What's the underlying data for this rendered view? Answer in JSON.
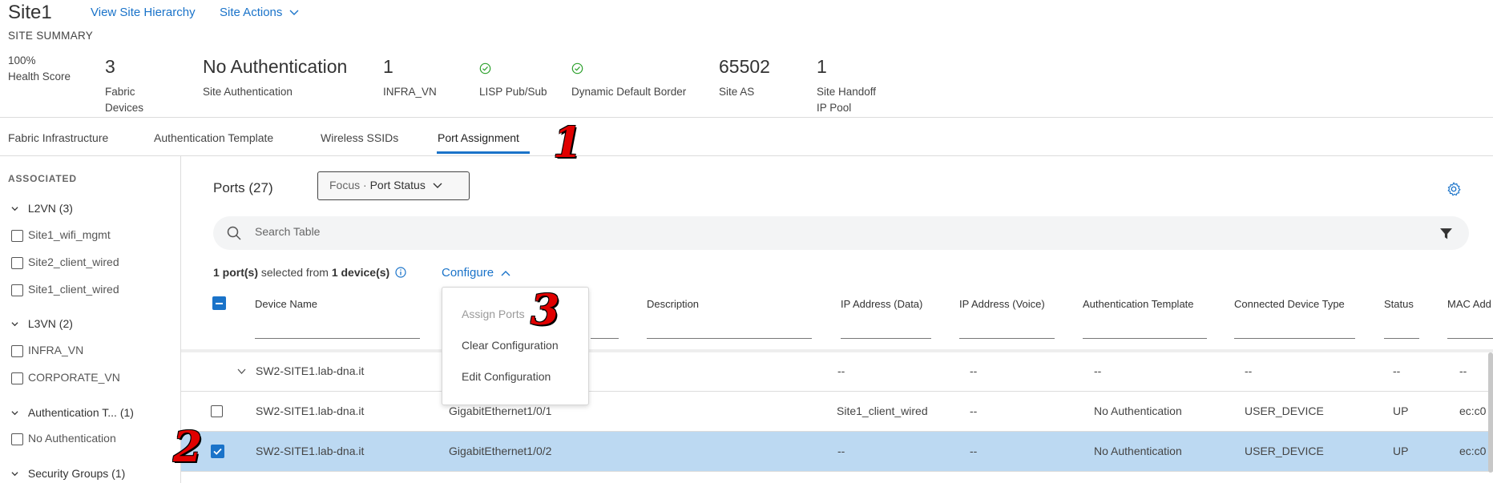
{
  "header": {
    "site_title": "Site1",
    "view_hierarchy": "View Site Hierarchy",
    "site_actions": "Site Actions",
    "site_summary": "SITE SUMMARY"
  },
  "summary": {
    "health_pct": "100%",
    "health_label": "Health Score",
    "fabric_devices_val": "3",
    "fabric_devices_lbl1": "Fabric",
    "fabric_devices_lbl2": "Devices",
    "auth_val": "No Authentication",
    "auth_lbl": "Site Authentication",
    "infra_val": "1",
    "infra_lbl": "INFRA_VN",
    "lisp_lbl": "LISP Pub/Sub",
    "ddb_lbl": "Dynamic Default Border",
    "as_val": "65502",
    "as_lbl": "Site AS",
    "handoff_val": "1",
    "handoff_lbl1": "Site Handoff",
    "handoff_lbl2": "IP Pool"
  },
  "tabs": [
    {
      "label": "Fabric Infrastructure"
    },
    {
      "label": "Authentication Template"
    },
    {
      "label": "Wireless SSIDs"
    },
    {
      "label": "Port Assignment"
    }
  ],
  "annotations": {
    "one": "1",
    "two": "2",
    "three": "3"
  },
  "sidebar": {
    "heading": "ASSOCIATED",
    "l2vn": "L2VN (3)",
    "l2vn_items": [
      "Site1_wifi_mgmt",
      "Site2_client_wired",
      "Site1_client_wired"
    ],
    "l3vn": "L3VN (2)",
    "l3vn_items": [
      "INFRA_VN",
      "CORPORATE_VN"
    ],
    "auth": "Authentication T... (1)",
    "auth_items": [
      "No Authentication"
    ],
    "sec": "Security Groups (1)"
  },
  "main": {
    "ports_title": "Ports (27)",
    "focus_prefix": "Focus · ",
    "focus_value": "Port Status",
    "search_placeholder": "Search Table",
    "sel_count": "1 port(s)",
    "sel_mid": " selected from ",
    "sel_devices": "1 device(s)",
    "configure": "Configure"
  },
  "columns": [
    "Device Name",
    "Description",
    "IP Address (Data)",
    "IP Address (Voice)",
    "Authentication Template",
    "Connected Device Type",
    "Status",
    "MAC Add"
  ],
  "menu": [
    "Assign Ports",
    "Clear Configuration",
    "Edit Configuration"
  ],
  "rows": [
    {
      "device": "SW2-SITE1.lab-dna.it",
      "ipdata": "--",
      "ipvoice": "--",
      "auth": "--",
      "type": "--",
      "status": "--",
      "mac": "--"
    },
    {
      "device": "SW2-SITE1.lab-dna.it",
      "port": "GigabitEthernet1/0/1",
      "ipdata": "Site1_client_wired",
      "ipvoice": "--",
      "auth": "No Authentication",
      "type": "USER_DEVICE",
      "status": "UP",
      "mac": "ec:c0"
    },
    {
      "device": "SW2-SITE1.lab-dna.it",
      "port": "GigabitEthernet1/0/2",
      "ipdata": "--",
      "ipvoice": "--",
      "auth": "No Authentication",
      "type": "USER_DEVICE",
      "status": "UP",
      "mac": "ec:c0"
    }
  ],
  "colors": {
    "accent": "#1a73c9",
    "selected_row": "#bcd9f2",
    "annotation": "#e00000",
    "ok": "#2ca02c"
  }
}
